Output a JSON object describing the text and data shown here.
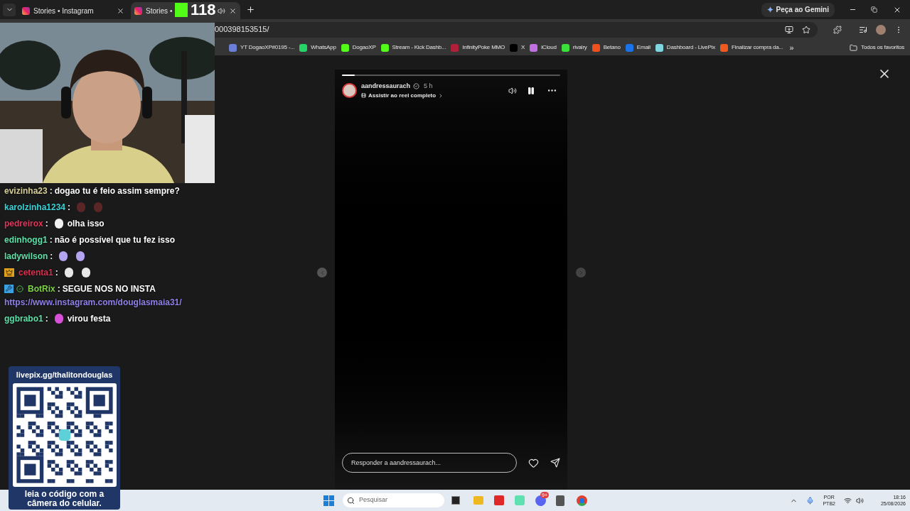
{
  "tabs": [
    {
      "title": "Stories • Instagram",
      "selected": false
    },
    {
      "title": "Stories •",
      "selected": true,
      "audio": true
    }
  ],
  "viewer_badge": {
    "count": "118"
  },
  "gemini_button": {
    "label": "Peça ao Gemini"
  },
  "address_bar": {
    "url": "000398153515/"
  },
  "bookmarks": [
    {
      "label": "YT DogaoXP#0195 -...",
      "color": "#6b7fd8"
    },
    {
      "label": "WhatsApp",
      "color": "#25d366"
    },
    {
      "label": "DogaoXP",
      "color": "#53fc18"
    },
    {
      "label": "Stream - Kick Dashb...",
      "color": "#53fc18"
    },
    {
      "label": "InfinityPoke MMO",
      "color": "#b0203a"
    },
    {
      "label": "X",
      "color": "#000000"
    },
    {
      "label": "iCloud",
      "color": "#c070e0"
    },
    {
      "label": "rivalry",
      "color": "#3be03b"
    },
    {
      "label": "Betano",
      "color": "#f0501e"
    },
    {
      "label": "Email",
      "color": "#1a73e8"
    },
    {
      "label": "Dashboard - LivePix",
      "color": "#7fd6e0"
    },
    {
      "label": "Finalizar compra da...",
      "color": "#f05a1e"
    }
  ],
  "bookmarks_more": "»",
  "all_bookmarks": "Todos os favoritos",
  "story": {
    "username": "aandressaurach",
    "verified": true,
    "age": "5 h",
    "reel_link": "Assistir ao reel completo",
    "progress": {
      "level": 0.06
    },
    "paused": false,
    "reply_placeholder": "Responder a aandressaurach..."
  },
  "chat": [
    {
      "user": "evizinha23",
      "color": "#d6cf98",
      "separator": ":",
      "text": "dogao tu é feio assim sempre?"
    },
    {
      "user": "karolzinha1234",
      "color": "#3ad4d8",
      "separator": ":",
      "emotes": [
        {
          "color": "#5a2626"
        },
        {
          "color": "#5a2626"
        }
      ]
    },
    {
      "user": "pedreirox",
      "color": "#e0385c",
      "separator": ":",
      "text": "olha isso",
      "emotes": [
        {
          "color": "#f0f0f0"
        }
      ]
    },
    {
      "user": "edinhogg1",
      "color": "#5ee0a8",
      "separator": ":",
      "text": "não é possível que tu fez isso"
    },
    {
      "user": "ladywilson",
      "color": "#5ee0a8",
      "separator": ":",
      "emotes": [
        {
          "color": "#b4a4f0"
        },
        {
          "color": "#b4a4f0"
        }
      ]
    },
    {
      "user": "cetenta1",
      "color": "#d83050",
      "separator": ":",
      "badges": [
        {
          "kind": "crown"
        }
      ],
      "emotes": [
        {
          "color": "#e8e8e8"
        },
        {
          "color": "#e8e8e8"
        }
      ]
    },
    {
      "user": "BotRix",
      "color": "#7ed24a",
      "separator": ":",
      "text": "SEGUE NOS NO INSTA",
      "badges": [
        {
          "kind": "bot"
        },
        {
          "kind": "verified"
        }
      ],
      "link": "https://www.instagram.com/douglasmaia31/"
    },
    {
      "user": "ggbrabo1",
      "color": "#5ee0a8",
      "separator": ":",
      "text": "virou festa",
      "emotes": [
        {
          "color": "#d850d8"
        }
      ]
    }
  ],
  "qr_card": {
    "url": "livepix.gg/thalitondouglas",
    "caption": "leia o código com a câmera do celular."
  },
  "taskbar": {
    "search_placeholder": "Pesquisar",
    "discord_badge": "9+",
    "language": "POR",
    "layout": "PTB2",
    "time": "18:16",
    "date": "25/08/2026"
  }
}
